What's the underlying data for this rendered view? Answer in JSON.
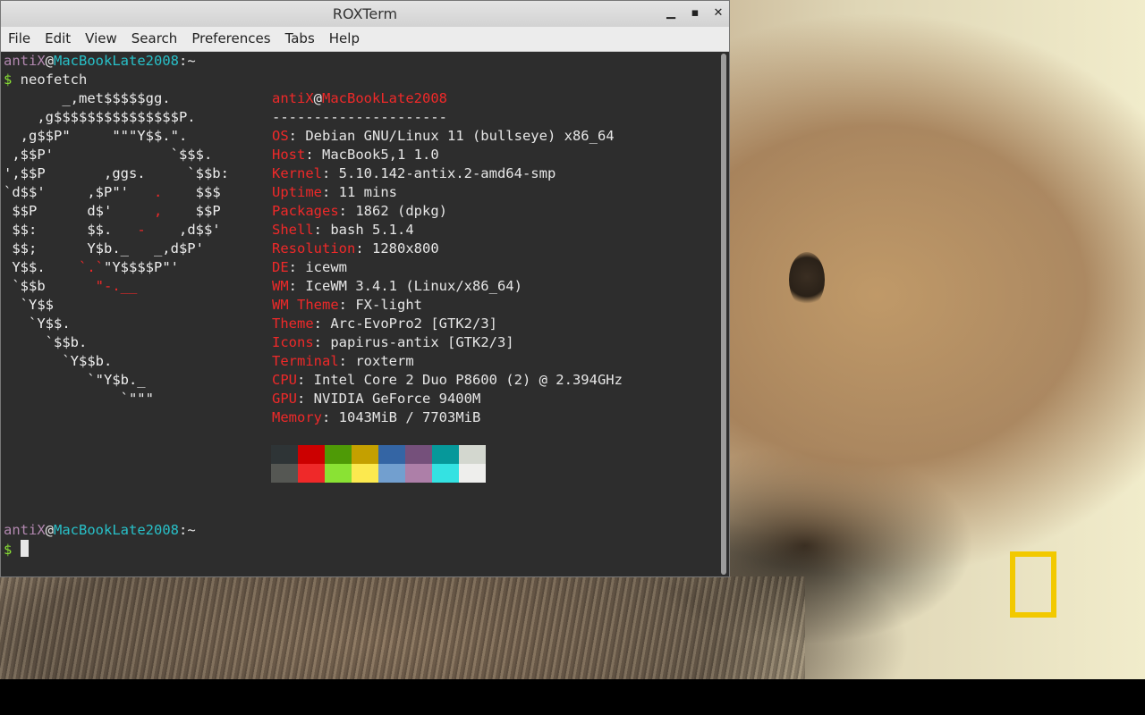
{
  "window": {
    "title": "ROXTerm",
    "minimize_glyph": "▁",
    "maximize_glyph": "▪",
    "close_glyph": "✕"
  },
  "menubar": {
    "items": [
      "File",
      "Edit",
      "View",
      "Search",
      "Preferences",
      "Tabs",
      "Help"
    ]
  },
  "prompt1": {
    "user": "antiX",
    "at": "@",
    "host": "MacBookLate2008",
    "path": ":~",
    "symbol": "$",
    "command": " neofetch"
  },
  "logo_lines": [
    "       _,met$$$$$gg.",
    "    ,g$$$$$$$$$$$$$$$P.",
    "  ,g$$P\"     \"\"\"Y$$.\".",
    " ,$$P'              `$$$.",
    "',$$P       ,ggs.     `$$b:",
    "`d$$'     ,$P\"'   ",
    " $$P      d$'     ",
    " $$:      $$.   ",
    " $$;      Y$b._   _,d$P'",
    " Y$$.    ",
    " `$$b      ",
    "  `Y$$",
    "   `Y$$.",
    "     `$$b.",
    "       `Y$$b.",
    "          `\"Y$b._",
    "              `\"\"\""
  ],
  "logo_parts": {
    "l5_red": ".",
    "l5_tail": "    $$$",
    "l6_red": ",",
    "l6_tail": "    $$P",
    "l7_red": "-",
    "l7_tail": "    ,d$$'",
    "l9_red": "`.`",
    "l9_tail": "\"Y$$$$P\"'",
    "l10_red": "\"-.__"
  },
  "neofetch": {
    "user": "antiX",
    "at": "@",
    "host": "MacBookLate2008",
    "separator": "---------------------",
    "fields": [
      {
        "key": "OS",
        "value": "Debian GNU/Linux 11 (bullseye) x86_64"
      },
      {
        "key": "Host",
        "value": "MacBook5,1 1.0"
      },
      {
        "key": "Kernel",
        "value": "5.10.142-antix.2-amd64-smp"
      },
      {
        "key": "Uptime",
        "value": "11 mins"
      },
      {
        "key": "Packages",
        "value": "1862 (dpkg)"
      },
      {
        "key": "Shell",
        "value": "bash 5.1.4"
      },
      {
        "key": "Resolution",
        "value": "1280x800"
      },
      {
        "key": "DE",
        "value": "icewm"
      },
      {
        "key": "WM",
        "value": "IceWM 3.4.1 (Linux/x86_64)"
      },
      {
        "key": "WM Theme",
        "value": "FX-light"
      },
      {
        "key": "Theme",
        "value": "Arc-EvoPro2 [GTK2/3]"
      },
      {
        "key": "Icons",
        "value": "papirus-antix [GTK2/3]"
      },
      {
        "key": "Terminal",
        "value": "roxterm"
      },
      {
        "key": "CPU",
        "value": "Intel Core 2 Duo P8600 (2) @ 2.394GHz"
      },
      {
        "key": "GPU",
        "value": "NVIDIA GeForce 9400M"
      },
      {
        "key": "Memory",
        "value": "1043MiB / 7703MiB"
      }
    ],
    "palette_row1": [
      "#2e3436",
      "#cc0000",
      "#4e9a06",
      "#c4a000",
      "#3465a4",
      "#75507b",
      "#06989a",
      "#d3d7cf"
    ],
    "palette_row2": [
      "#555753",
      "#ef2929",
      "#8ae234",
      "#fce94f",
      "#729fcf",
      "#ad7fa8",
      "#34e2e2",
      "#eeeeec"
    ]
  },
  "prompt2": {
    "user": "antiX",
    "at": "@",
    "host": "MacBookLate2008",
    "path": ":~",
    "symbol": "$"
  },
  "colors": {
    "user": "#b288b0",
    "host": "#28c0c8",
    "prompt_symbol": "#8ae234",
    "key": "#ef2929",
    "natgeo_yellow": "#f2c900"
  }
}
